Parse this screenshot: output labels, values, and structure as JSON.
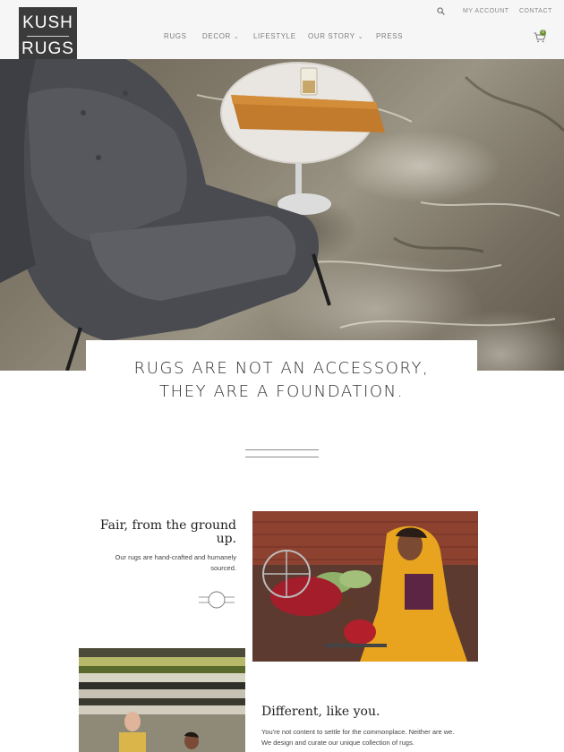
{
  "logo": {
    "line1": "KUSH",
    "line2": "RUGS"
  },
  "utility": {
    "account": "MY ACCOUNT",
    "contact": "CONTACT"
  },
  "nav": {
    "rugs": "RUGS",
    "decor": "DECOR",
    "lifestyle": "LIFESTYLE",
    "our_story": "OUR STORY",
    "press": "PRESS"
  },
  "cart": {
    "count": "0"
  },
  "hero": {
    "tagline_line1": "RUGS ARE NOT AN ACCESSORY,",
    "tagline_line2": "THEY ARE A FOUNDATION."
  },
  "fair": {
    "title": "Fair, from the ground up.",
    "text": "Our rugs are hand-crafted and humanely sourced."
  },
  "different": {
    "title": "Different, like you.",
    "text": "You're not content to settle for the commonplace. Neither are we. We design and curate our unique collection of rugs."
  },
  "colors": {
    "header_bg": "#f6f6f6",
    "logo_bg": "#3b3b3b",
    "accent_green": "#6b8f2e"
  },
  "icons": {
    "search": "search-icon",
    "cart": "cart-icon",
    "chevron": "chevron-down-icon"
  }
}
